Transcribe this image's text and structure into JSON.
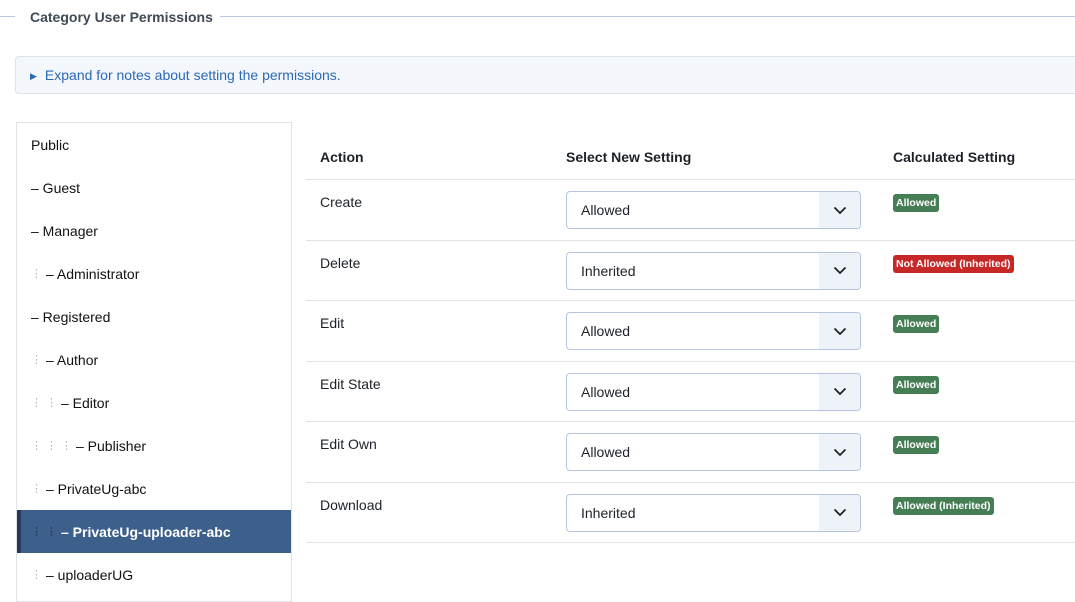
{
  "fieldset": {
    "legend": "Category User Permissions"
  },
  "notes": {
    "label": "Expand for notes about setting the permissions."
  },
  "groups": [
    {
      "label": "Public",
      "depth": 0,
      "selected": false
    },
    {
      "label": "– Guest",
      "depth": 0,
      "selected": false
    },
    {
      "label": "– Manager",
      "depth": 0,
      "selected": false
    },
    {
      "label": "– Administrator",
      "depth": 1,
      "selected": false
    },
    {
      "label": "– Registered",
      "depth": 0,
      "selected": false
    },
    {
      "label": "– Author",
      "depth": 1,
      "selected": false
    },
    {
      "label": "– Editor",
      "depth": 2,
      "selected": false
    },
    {
      "label": "– Publisher",
      "depth": 3,
      "selected": false
    },
    {
      "label": "– PrivateUg-abc",
      "depth": 1,
      "selected": false
    },
    {
      "label": "– PrivateUg-uploader-abc",
      "depth": 2,
      "selected": true
    },
    {
      "label": "– uploaderUG",
      "depth": 1,
      "selected": false
    }
  ],
  "table": {
    "headers": [
      "Action",
      "Select New Setting",
      "Calculated Setting"
    ],
    "rows": [
      {
        "action": "Create",
        "setting": "Allowed",
        "calculated": "Allowed",
        "status": "allowed"
      },
      {
        "action": "Delete",
        "setting": "Inherited",
        "calculated": "Not Allowed (Inherited)",
        "status": "denied"
      },
      {
        "action": "Edit",
        "setting": "Allowed",
        "calculated": "Allowed",
        "status": "allowed"
      },
      {
        "action": "Edit State",
        "setting": "Allowed",
        "calculated": "Allowed",
        "status": "allowed"
      },
      {
        "action": "Edit Own",
        "setting": "Allowed",
        "calculated": "Allowed",
        "status": "allowed"
      },
      {
        "action": "Download",
        "setting": "Inherited",
        "calculated": "Allowed (Inherited)",
        "status": "allowed"
      }
    ]
  },
  "colors": {
    "allowed": "#457d54",
    "denied": "#c52827",
    "selected": "#3d5f8c",
    "link": "#2a69b8"
  }
}
